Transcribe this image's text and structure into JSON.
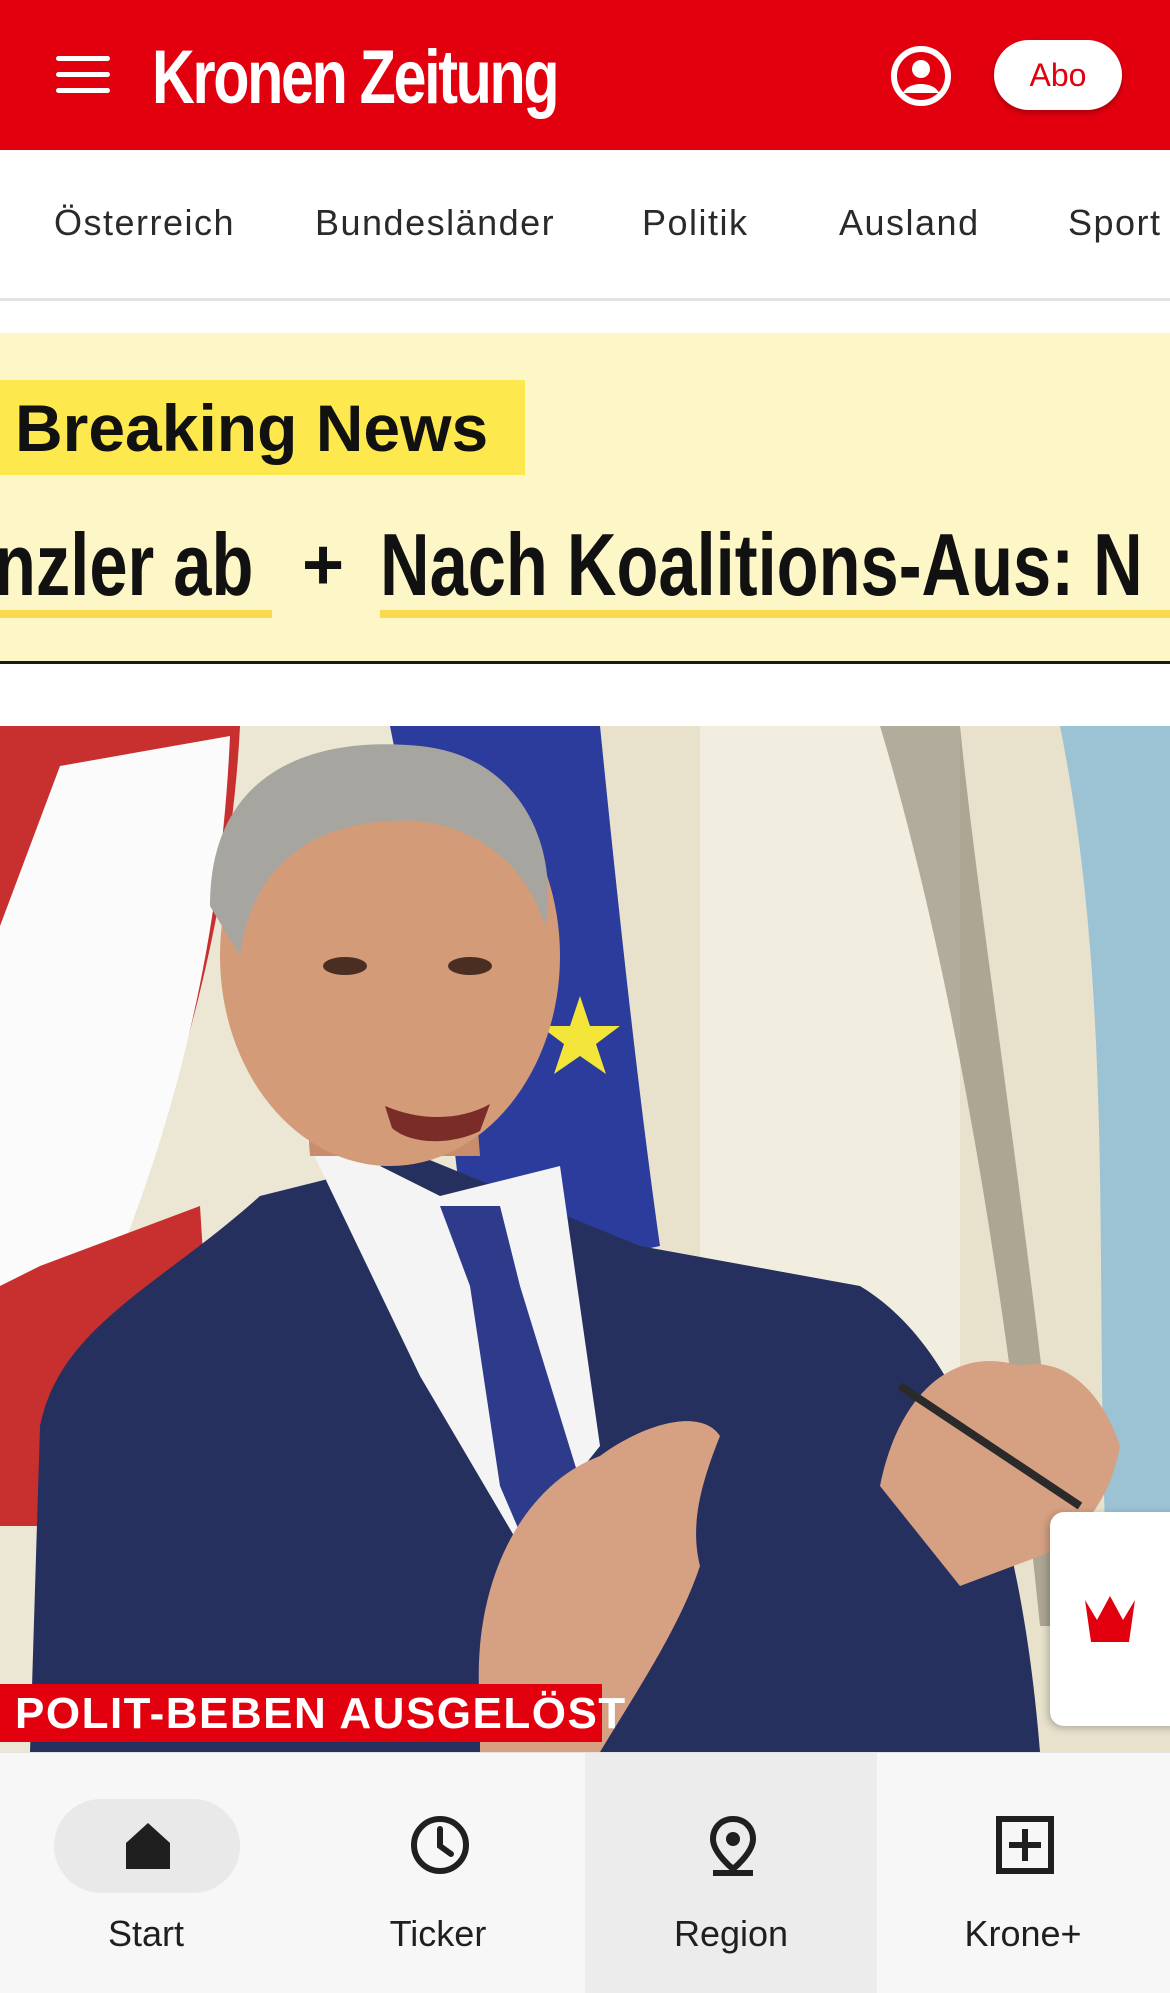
{
  "header": {
    "logo": "Kronen Zeitung",
    "abo_label": "Abo",
    "brand_color": "#e2000f",
    "icons": [
      "menu-icon",
      "user-account-icon"
    ]
  },
  "categories": [
    "Österreich",
    "Bundesländer",
    "Politik",
    "Ausland",
    "Sport"
  ],
  "breaking": {
    "label": "Breaking News",
    "ticker": [
      "nzler ab",
      "+",
      "Nach Koalitions-Aus: N"
    ]
  },
  "hero": {
    "kicker": "POLIT-BEBEN AUSGELÖST",
    "badge_icon": "krone-crown-icon"
  },
  "bottom_nav": [
    {
      "label": "Start",
      "icon": "home-icon",
      "active": true
    },
    {
      "label": "Ticker",
      "icon": "clock-icon",
      "active": false
    },
    {
      "label": "Region",
      "icon": "location-pin-icon",
      "active": false
    },
    {
      "label": "Krone+",
      "icon": "plus-box-icon",
      "active": false
    }
  ]
}
